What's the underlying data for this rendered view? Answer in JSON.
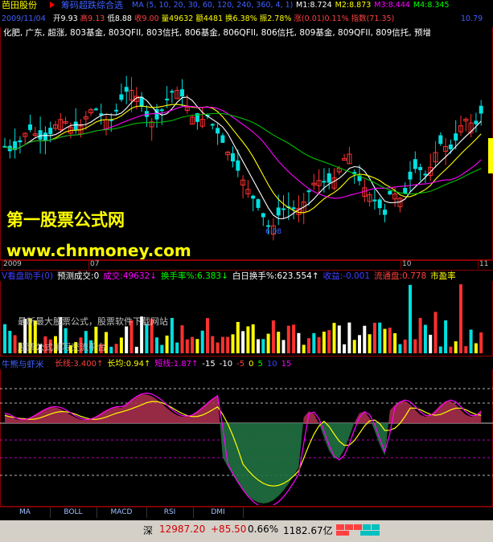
{
  "stock": {
    "name": "芭田股份"
  },
  "main_indicator": {
    "title": "筹码超跌综合选",
    "params": "MA (5, 10, 20, 30, 60, 120, 240, 360, 4, 1)",
    "items": [
      {
        "text": "M1:8.724",
        "color": "#ffffff"
      },
      {
        "text": "M2:8.873",
        "color": "#ffff00"
      },
      {
        "text": "M3:8.444",
        "color": "#ff00ff"
      },
      {
        "text": "M4:8.345",
        "color": "#00ff00"
      }
    ]
  },
  "ohlc": {
    "date": "2009/11/04",
    "items": [
      {
        "text": "开9.93",
        "color": "#ffffff"
      },
      {
        "text": "高9.13",
        "color": "#ff4040"
      },
      {
        "text": "低8.88",
        "color": "#ffffff"
      },
      {
        "text": "收9.00",
        "color": "#ff4040"
      },
      {
        "text": "量49632",
        "color": "#ffff00"
      },
      {
        "text": "额4481",
        "color": "#ffff00"
      },
      {
        "text": "换6.38%",
        "color": "#ffff00"
      },
      {
        "text": "振2.78%",
        "color": "#ffff00"
      },
      {
        "text": "涨(0.01)0.11%",
        "color": "#ff4040"
      },
      {
        "text": "指数(71.35)",
        "color": "#ff4040"
      }
    ],
    "right_value": "10.79"
  },
  "sectors": "化肥, 广东, 超涨, 803基金, 803QFII, 803信托, 806基金, 806QFII, 806信托, 809基金, 809QFII, 809信托, 预增",
  "watermark": {
    "line1": "第一股票公式网",
    "line2": "www.chnmoney.com"
  },
  "low_label": "6.08",
  "time_axis": [
    {
      "label": "2009",
      "color": "#c0c0c0"
    },
    {
      "label": "07",
      "color": "#c0c0c0"
    },
    {
      "label": "10",
      "color": "#c0c0c0"
    },
    {
      "label": "11",
      "color": "#c0c0c0"
    }
  ],
  "volume_panel": {
    "items": [
      {
        "text": "V看盘助手(0)",
        "color": "#4040ff"
      },
      {
        "text": "预测成交:0",
        "color": "#ffffff"
      },
      {
        "text": "成交:49632↓",
        "color": "#ff00ff"
      },
      {
        "text": "换手率%:6.383↓",
        "color": "#00ff00"
      },
      {
        "text": "白日换手%:623.554↑",
        "color": "#ffffff"
      },
      {
        "text": "收益:-0.001",
        "color": "#4040ff"
      },
      {
        "text": "流通盘:0.778",
        "color": "#ff4040"
      },
      {
        "text": "市盈率",
        "color": "#ffff00"
      }
    ],
    "ad_line1": "最新最大股票公式，股票软件下载网站",
    "ad_line2": "股票公式编写交流平台"
  },
  "oscillator": {
    "name": "牛熊与虾米",
    "items": [
      {
        "text": "长线:3.400↑",
        "color": "#ff4040"
      },
      {
        "text": "长均:0.94↑",
        "color": "#ffff00"
      },
      {
        "text": "短线:1.87↑",
        "color": "#ff00ff"
      },
      {
        "text": "-15",
        "color": "#ffffff"
      },
      {
        "text": "-10",
        "color": "#ffffff"
      },
      {
        "text": "-5",
        "color": "#ff4040"
      },
      {
        "text": "0",
        "color": "#ffff00"
      },
      {
        "text": "5",
        "color": "#00ff00"
      },
      {
        "text": "10",
        "color": "#4040ff"
      },
      {
        "text": "15",
        "color": "#ff00ff"
      }
    ]
  },
  "tabs": [
    "MA",
    "BOLL",
    "MACD",
    "RSI",
    "DMI"
  ],
  "status": {
    "market": "深",
    "index": "12987.20",
    "change": "+85.50",
    "pct": "0.66%",
    "amount": "1182.67亿"
  }
}
